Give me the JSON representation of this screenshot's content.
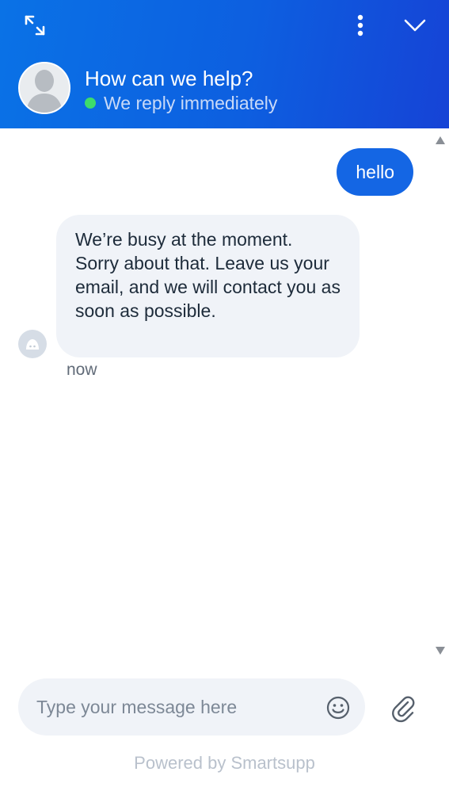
{
  "header": {
    "title": "How can we help?",
    "status": "We reply immediately",
    "status_color": "#3ddc6b",
    "icons": {
      "expand": "expand-arrows-icon",
      "menu": "vertical-dots-icon",
      "collapse": "chevron-down-icon"
    }
  },
  "messages": [
    {
      "direction": "outgoing",
      "text": "hello"
    },
    {
      "direction": "incoming",
      "text": "We’re busy at the moment. Sorry about that. Leave us your email, and we will contact you as soon as possible.",
      "time": "now"
    }
  ],
  "composer": {
    "placeholder": "Type your message here",
    "value": "",
    "icons": {
      "emoji": "smiley-icon",
      "attach": "paperclip-icon"
    }
  },
  "footer": {
    "powered_by": "Powered by Smartsupp"
  },
  "colors": {
    "accent": "#1466e4",
    "bubble_incoming": "#f0f3f8"
  }
}
